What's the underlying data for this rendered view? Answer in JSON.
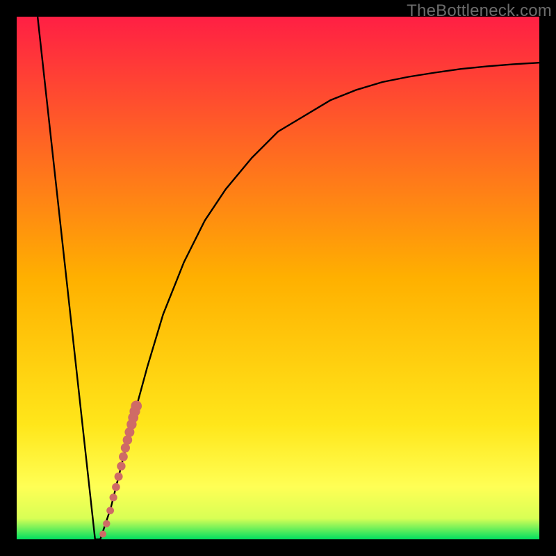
{
  "watermark": "TheBottleneck.com",
  "colors": {
    "gradient_top": "#ff1f44",
    "gradient_mid": "#ffd200",
    "gradient_low_yellow": "#ffff55",
    "gradient_bottom": "#00e060",
    "curve": "#000000",
    "marker": "#cf6b66",
    "frame_bg": "#000000"
  },
  "chart_data": {
    "type": "line",
    "title": "",
    "xlabel": "",
    "ylabel": "",
    "xlim": [
      0,
      100
    ],
    "ylim": [
      0,
      100
    ],
    "grid": false,
    "legend": false,
    "series": [
      {
        "name": "bottleneck-curve",
        "x": [
          4,
          15,
          16,
          18,
          20,
          22,
          25,
          28,
          32,
          36,
          40,
          45,
          50,
          55,
          60,
          65,
          70,
          75,
          80,
          85,
          90,
          95,
          100
        ],
        "y": [
          100,
          0,
          0,
          6,
          14,
          22,
          33,
          43,
          53,
          61,
          67,
          73,
          78,
          81,
          84,
          86,
          87.5,
          88.5,
          89.3,
          90,
          90.5,
          90.9,
          91.2
        ]
      }
    ],
    "markers": {
      "name": "highlight-dots",
      "x": [
        16.5,
        17.2,
        17.9,
        18.5,
        19.0,
        19.5,
        20.0,
        20.4,
        20.8,
        21.2,
        21.6,
        22.0,
        22.3,
        22.6,
        22.9
      ],
      "y": [
        1.0,
        3.0,
        5.5,
        8.0,
        10.0,
        12.0,
        14.0,
        15.8,
        17.5,
        19.0,
        20.5,
        22.0,
        23.3,
        24.5,
        25.5
      ]
    }
  }
}
